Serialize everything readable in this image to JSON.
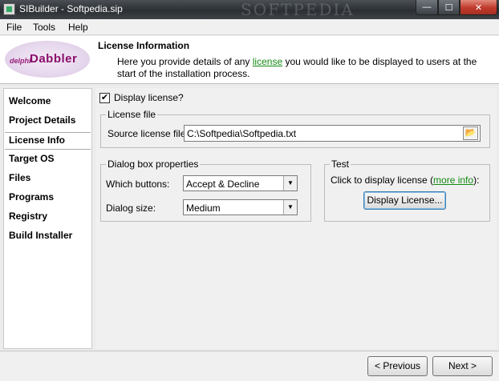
{
  "window": {
    "title": "SIBuilder - Softpedia.sip",
    "watermark": "SOFTPEDIA",
    "min_label": "—",
    "max_label": "☐",
    "close_label": "✕"
  },
  "menu": {
    "items": [
      "File",
      "Tools",
      "Help"
    ]
  },
  "logo": {
    "prefix": "delphi",
    "name": "Dabbler"
  },
  "header": {
    "title": "License Information",
    "desc_before": "Here you provide details of any ",
    "desc_link": "license",
    "desc_after": " you would like to be displayed to users at the start of the installation process."
  },
  "sidebar": {
    "items": [
      {
        "label": "Welcome",
        "active": false
      },
      {
        "label": "Project Details",
        "active": false
      },
      {
        "label": "License Info",
        "active": true
      },
      {
        "label": "Target OS",
        "active": false
      },
      {
        "label": "Files",
        "active": false
      },
      {
        "label": "Programs",
        "active": false
      },
      {
        "label": "Registry",
        "active": false
      },
      {
        "label": "Build Installer",
        "active": false
      }
    ]
  },
  "main": {
    "display_license_label": "Display license?",
    "display_license_checked": true,
    "checkmark": "✔",
    "license_file": {
      "group_title": "License file",
      "source_label": "Source license file:",
      "source_value": "C:\\Softpedia\\Softpedia.txt",
      "browse_icon": "📂"
    },
    "dialog_box": {
      "group_title": "Dialog box properties",
      "buttons_label": "Which buttons:",
      "buttons_value": "Accept & Decline",
      "size_label": "Dialog size:",
      "size_value": "Medium",
      "arrow": "▼"
    },
    "test": {
      "group_title": "Test",
      "text_before": "Click to display license (",
      "text_link": "more info",
      "text_after": "):",
      "button_label": "Display License..."
    }
  },
  "footer": {
    "previous_label": "< Previous",
    "next_label": "Next >"
  },
  "colors": {
    "link": "#138a13",
    "logo": "#8a0e6a",
    "close": "#c0392b"
  }
}
